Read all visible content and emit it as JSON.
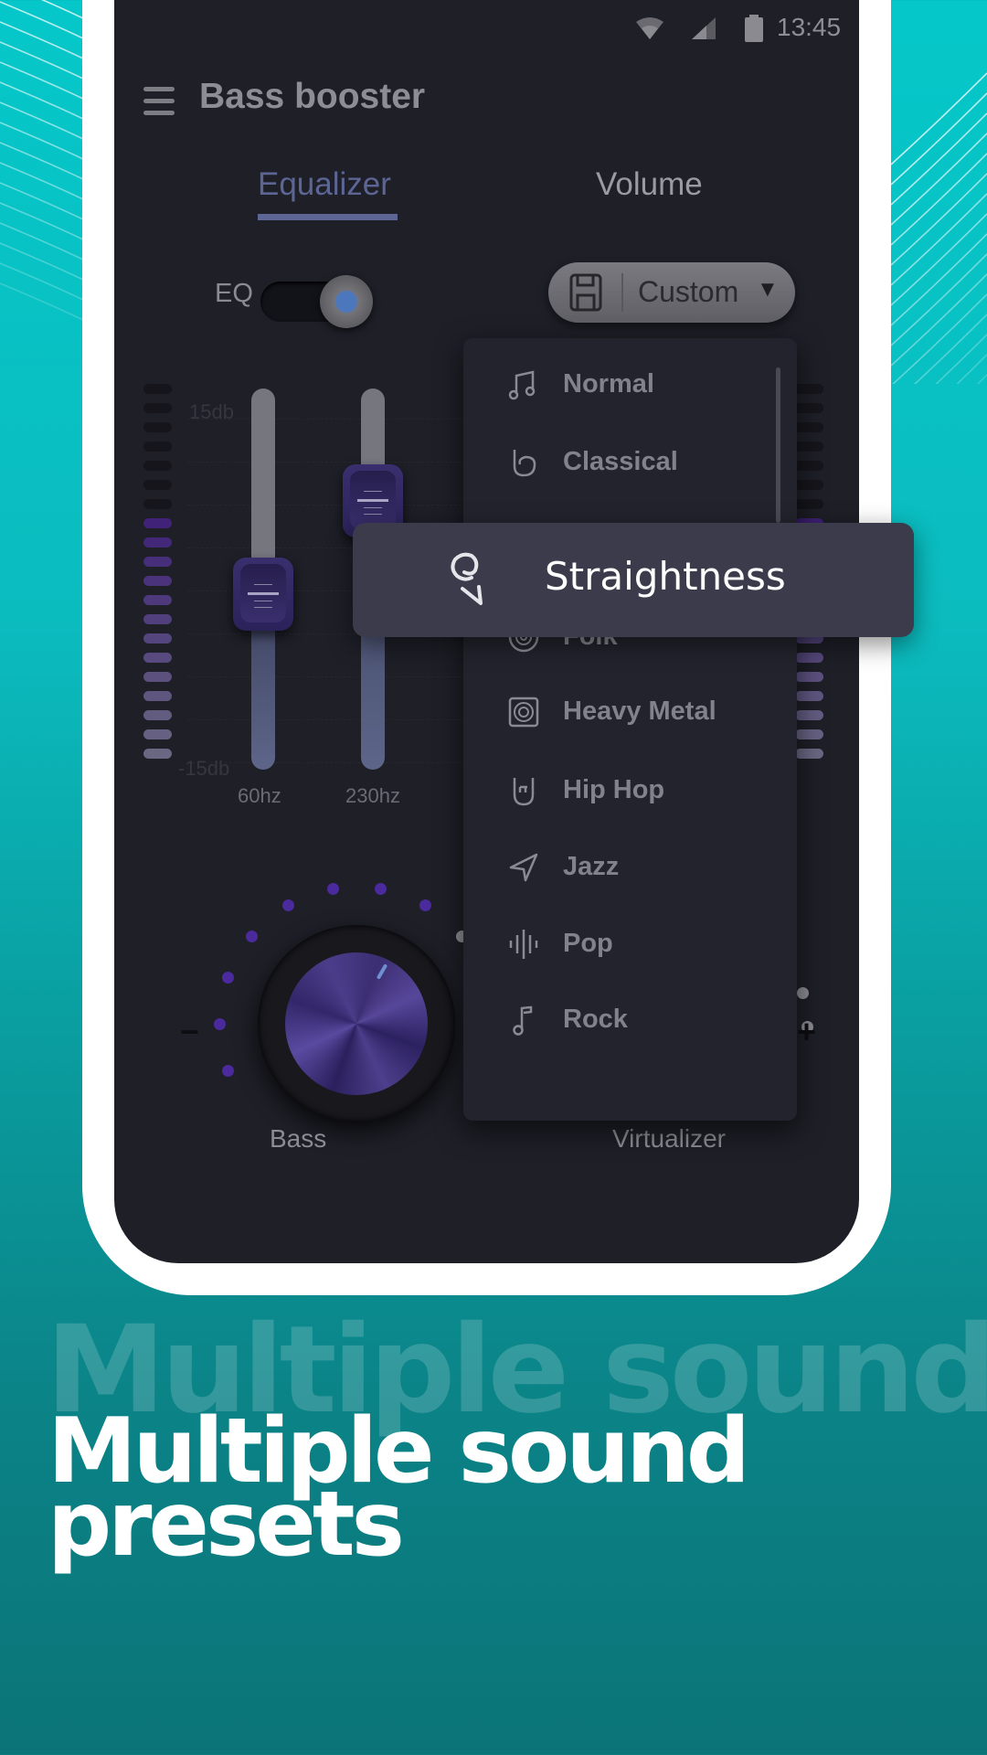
{
  "status_bar": {
    "time": "13:45",
    "icons": [
      "wifi-icon",
      "signal-icon",
      "battery-icon"
    ]
  },
  "app_bar": {
    "menu_icon": "hamburger-menu-icon",
    "title": "Bass booster"
  },
  "tabs": [
    {
      "label": "Equalizer",
      "active": true
    },
    {
      "label": "Volume",
      "active": false
    }
  ],
  "eq_toggle": {
    "label": "EQ",
    "on": false
  },
  "preset_button": {
    "icon": "save-icon",
    "label": "Custom",
    "caret": "▼"
  },
  "equalizer": {
    "db_max_label": "15db",
    "db_min_label": "-15db",
    "bands": [
      {
        "label": "60hz",
        "value_db": 0
      },
      {
        "label": "230hz",
        "value_db": 8
      }
    ]
  },
  "preset_dropdown": {
    "items": [
      {
        "label": "Normal",
        "icon": "music-note-icon"
      },
      {
        "label": "Classical",
        "icon": "saxophone-icon"
      },
      {
        "label": "Folk",
        "icon": "vinyl-disc-icon"
      },
      {
        "label": "Heavy Metal",
        "icon": "speaker-icon"
      },
      {
        "label": "Hip Hop",
        "icon": "rock-hand-icon"
      },
      {
        "label": "Jazz",
        "icon": "trumpet-icon"
      },
      {
        "label": "Pop",
        "icon": "sound-wave-icon"
      },
      {
        "label": "Rock",
        "icon": "single-note-icon"
      }
    ],
    "highlighted": {
      "label": "Straightness",
      "icon": "straightness-icon"
    }
  },
  "knobs": [
    {
      "label": "Bass",
      "minus": "−",
      "plus": "+",
      "level_dots_lit": 8,
      "level_dots_total": 12
    },
    {
      "label": "Virtualizer",
      "minus": "−",
      "plus": "+"
    }
  ],
  "promo": {
    "ghost_text": "Multiple sound",
    "headline_line1": "Multiple sound",
    "headline_line2": "presets"
  },
  "colors": {
    "accent": "#5c6593",
    "background_teal": "#0bbcbf",
    "screen_bg": "#1e1f27",
    "purple_active": "#4a2a9c"
  }
}
